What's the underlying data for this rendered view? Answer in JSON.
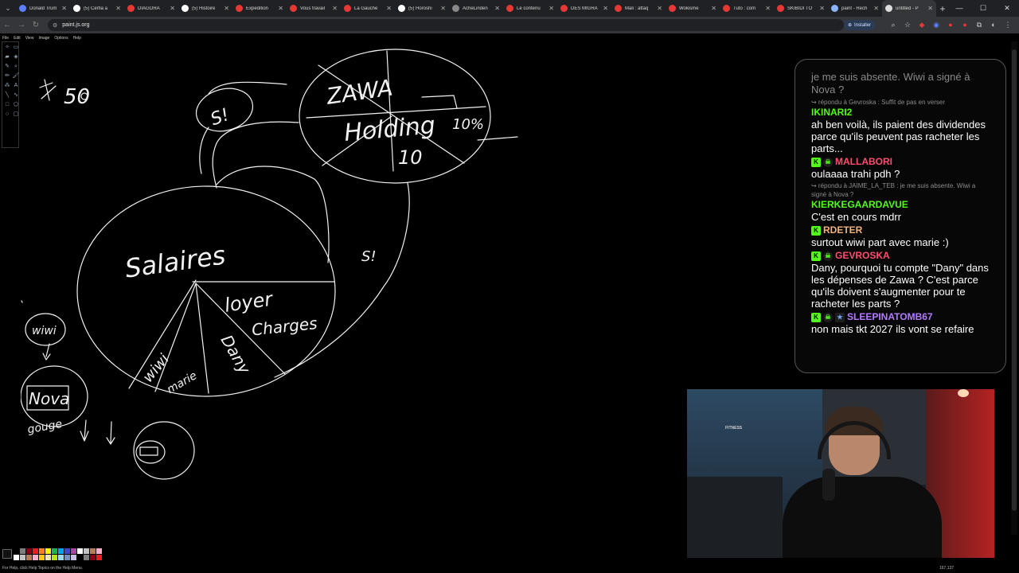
{
  "tabs": [
    {
      "title": "Donald Trum",
      "color": "#5b7fff"
    },
    {
      "title": "(5) Cerfia a",
      "color": "#ffffff"
    },
    {
      "title": "DIAGORA",
      "color": "#e53935"
    },
    {
      "title": "(5) Histoire",
      "color": "#ffffff"
    },
    {
      "title": "Expedition",
      "color": "#e53935"
    },
    {
      "title": "Vous travail",
      "color": "#e53935"
    },
    {
      "title": "La Gauche",
      "color": "#e53935"
    },
    {
      "title": "(5) Horoshi",
      "color": "#ffffff"
    },
    {
      "title": "AcheLinden",
      "color": "#888888"
    },
    {
      "title": "Le contenu",
      "color": "#e53935"
    },
    {
      "title": "DES MIGRA",
      "color": "#e53935"
    },
    {
      "title": "Mali : attaq",
      "color": "#e53935"
    },
    {
      "title": "Wokisme",
      "color": "#e53935"
    },
    {
      "title": "Tuto : com",
      "color": "#e53935"
    },
    {
      "title": "SKIBIDI TO",
      "color": "#e53935"
    },
    {
      "title": "paint - Rech",
      "color": "#8ab4f8"
    },
    {
      "title": "untitled - P",
      "color": "#dddddd",
      "active": true
    }
  ],
  "address": {
    "url": "paint.js.org",
    "install_label": "Installer"
  },
  "paint": {
    "menu": [
      "File",
      "Edit",
      "View",
      "Image",
      "Options",
      "Help"
    ],
    "status_help": "For Help, click Help Topics on the Help Menu.",
    "status_pos": "167,137",
    "palette_colors": [
      "#000000",
      "#7f7f7f",
      "#880015",
      "#ed1c24",
      "#ff7f27",
      "#fff200",
      "#22b14c",
      "#00a2e8",
      "#3f48cc",
      "#a349a4",
      "#ffffff",
      "#c3c3c3",
      "#b97a57",
      "#ffaec9",
      "#ffffff",
      "#c3c3c3",
      "#b97a57",
      "#ffaec9",
      "#ffc90e",
      "#efe4b0",
      "#b5e61d",
      "#99d9ea",
      "#7092be",
      "#c8bfe7",
      "#000000",
      "#7f7f7f",
      "#880015",
      "#ed1c24"
    ]
  },
  "drawing": {
    "holding_word1": "ZAWA",
    "holding_word2": "Holding",
    "holding_pct1": "10%",
    "holding_pct2": "10",
    "si_top": "S!",
    "si_right": "S!",
    "salaires": "Salaires",
    "loyer": "loyer",
    "charges": "Charges",
    "wiwi": "wiwi",
    "marie": "marie",
    "dany": "Dany",
    "wiwi_circle": "wiwi",
    "nova": "Nova",
    "nova_sub": "gouge",
    "fifty": "50"
  },
  "chat": {
    "fade_text": "je me suis absente. Wiwi a signé à Nova ?",
    "messages": [
      {
        "reply": "↪ répondu à Gevroska : Suffit de pas en verser",
        "user": "IKINARI2",
        "color": "#53fc18",
        "badges": [],
        "text": "ah ben voilà, ils paient des dividendes parce qu'ils peuvent pas racheter les parts..."
      },
      {
        "reply": "",
        "user": "MALLABORI",
        "color": "#ff4d6d",
        "badges": [
          "K",
          "skull"
        ],
        "text": "oulaaaa trahi pdh ?"
      },
      {
        "reply": "↪ répondu à JAIME_LA_TEB : je me suis absente. Wiwi a signé à Nova ?",
        "user": "KIERKEGAARDAVUE",
        "color": "#53fc18",
        "badges": [],
        "text": "C'est en cours mdrr"
      },
      {
        "reply": "",
        "user": "RDETER",
        "color": "#f2b37c",
        "badges": [
          "K"
        ],
        "text": "surtout wiwi part avec marie :)"
      },
      {
        "reply": "",
        "user": "GEVROSKA",
        "color": "#ff4d6d",
        "badges": [
          "K",
          "skull"
        ],
        "text": "Dany, pourquoi tu compte \"Dany\" dans les dépenses de Zawa ? C'est parce qu'ils doivent s'augmenter pour te racheter les parts ?"
      },
      {
        "reply": "",
        "user": "SLEEPINATOMB67",
        "color": "#b27cff",
        "badges": [
          "K",
          "skull",
          "sub"
        ],
        "text": "non mais tkt 2027 ils vont se refaire"
      }
    ]
  },
  "webcam": {
    "poster_text": "FITNESS"
  }
}
